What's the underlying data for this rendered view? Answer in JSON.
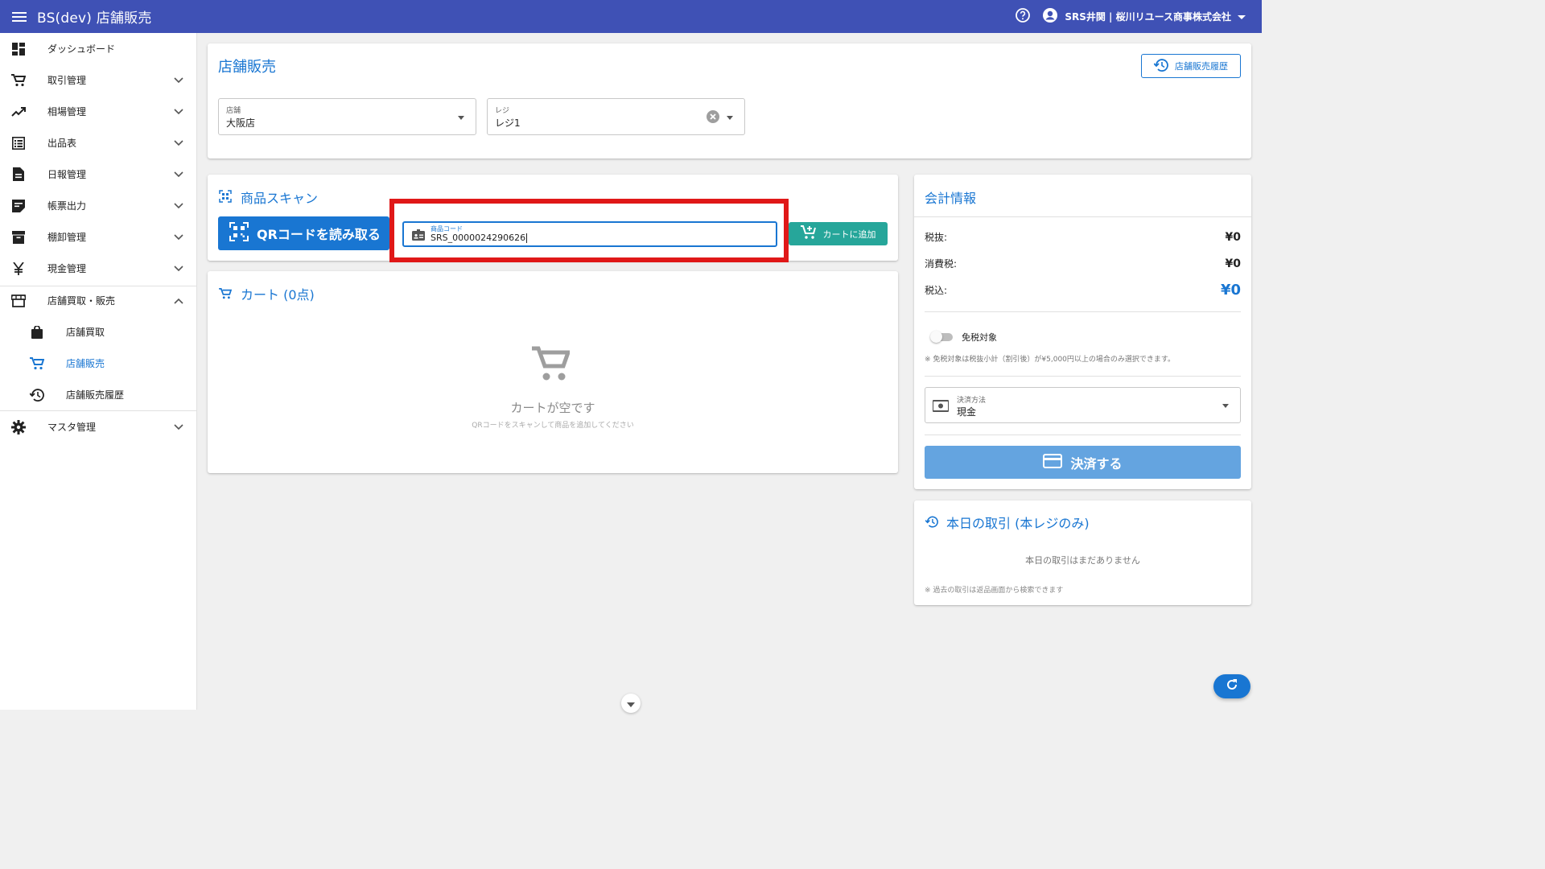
{
  "appbar": {
    "title": "BS(dev) 店舗販売",
    "user": "SRS井関 | 桜川リユース商事株式会社"
  },
  "sidebar": {
    "items": [
      {
        "label": "ダッシュボード",
        "icon": "dashboard-icon"
      },
      {
        "label": "取引管理",
        "icon": "cart-icon"
      },
      {
        "label": "相場管理",
        "icon": "trending-up-icon"
      },
      {
        "label": "出品表",
        "icon": "list-icon"
      },
      {
        "label": "日報管理",
        "icon": "document-icon"
      },
      {
        "label": "帳票出力",
        "icon": "note-icon"
      },
      {
        "label": "棚卸管理",
        "icon": "archive-icon"
      },
      {
        "label": "現金管理",
        "icon": "yen-icon"
      },
      {
        "label": "店舗買取・販売",
        "icon": "store-icon"
      },
      {
        "label": "店舗買取",
        "icon": "bag-icon"
      },
      {
        "label": "店舗販売",
        "icon": "cart-icon"
      },
      {
        "label": "店舗販売履歴",
        "icon": "history-icon"
      },
      {
        "label": "マスタ管理",
        "icon": "gear-icon"
      }
    ]
  },
  "header_card": {
    "title": "店舗販売",
    "history_button": "店舗販売履歴",
    "store_label": "店舗",
    "store_value": "大阪店",
    "register_label": "レジ",
    "register_value": "レジ1"
  },
  "scan_card": {
    "title": "商品スキャン",
    "qr_button": "QRコードを読み取る",
    "code_label": "商品コード",
    "code_value": "SRS_0000024290626",
    "add_to_cart_button": "カートに追加"
  },
  "cart_card": {
    "title": "カート (0点)",
    "empty_title": "カートが空です",
    "empty_hint": "QRコードをスキャンして商品を追加してください"
  },
  "accounting_card": {
    "title": "会計情報",
    "subtotal_label": "税抜:",
    "subtotal_value": "¥0",
    "tax_label": "消費税:",
    "tax_value": "¥0",
    "total_label": "税込:",
    "total_value": "¥0",
    "tax_exempt_label": "免税対象",
    "tax_exempt_on": false,
    "tax_exempt_note": "※ 免税対象は税抜小計（割引後）が¥5,000円以上の場合のみ選択できます。",
    "payment_label": "決済方法",
    "payment_value": "現金",
    "pay_button": "決済する"
  },
  "today_card": {
    "title": "本日の取引 (本レジのみ)",
    "empty": "本日の取引はまだありません",
    "note": "※ 過去の取引は返品画面から検索できます"
  },
  "colors": {
    "appbar": "#3f51b5",
    "primary": "#1976d2",
    "teal": "#26a69a",
    "highlight": "#e01818",
    "pay_button": "#64a4e0"
  }
}
